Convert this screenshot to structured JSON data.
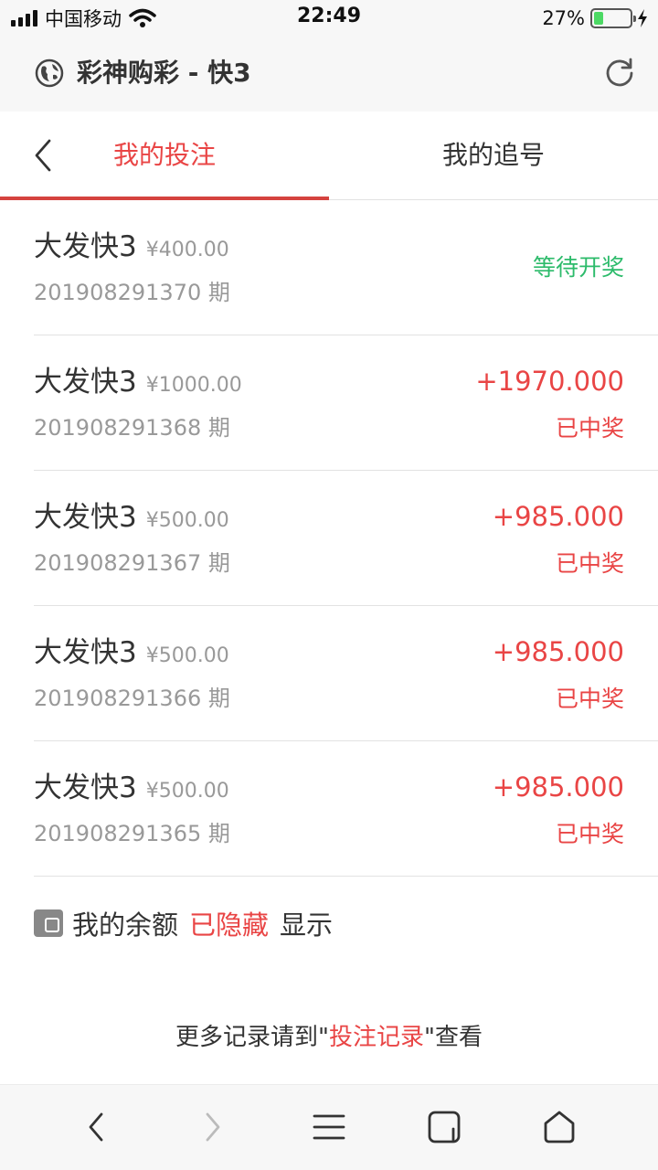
{
  "status_bar": {
    "carrier": "中国移动",
    "time": "22:49",
    "battery_percent": "27%",
    "battery_level": 0.27
  },
  "browser": {
    "title": "彩神购彩 - 快3"
  },
  "tabs": [
    {
      "label": "我的投注",
      "active": true
    },
    {
      "label": "我的追号",
      "active": false
    }
  ],
  "bets": [
    {
      "game": "大发快3",
      "stake": "¥400.00",
      "period": "201908291370 期",
      "amount": "",
      "status": "等待开奖"
    },
    {
      "game": "大发快3",
      "stake": "¥1000.00",
      "period": "201908291368 期",
      "amount": "+1970.000",
      "status": "已中奖"
    },
    {
      "game": "大发快3",
      "stake": "¥500.00",
      "period": "201908291367 期",
      "amount": "+985.000",
      "status": "已中奖"
    },
    {
      "game": "大发快3",
      "stake": "¥500.00",
      "period": "201908291366 期",
      "amount": "+985.000",
      "status": "已中奖"
    },
    {
      "game": "大发快3",
      "stake": "¥500.00",
      "period": "201908291365 期",
      "amount": "+985.000",
      "status": "已中奖"
    }
  ],
  "balance": {
    "label": "我的余额",
    "hidden_text": "已隐藏",
    "show_text": "显示"
  },
  "footer": {
    "prefix": "更多记录请到\"",
    "link": "投注记录",
    "suffix": "\"查看"
  },
  "colors": {
    "accent_red": "#e94545",
    "pending_green": "#2dbb6b"
  }
}
